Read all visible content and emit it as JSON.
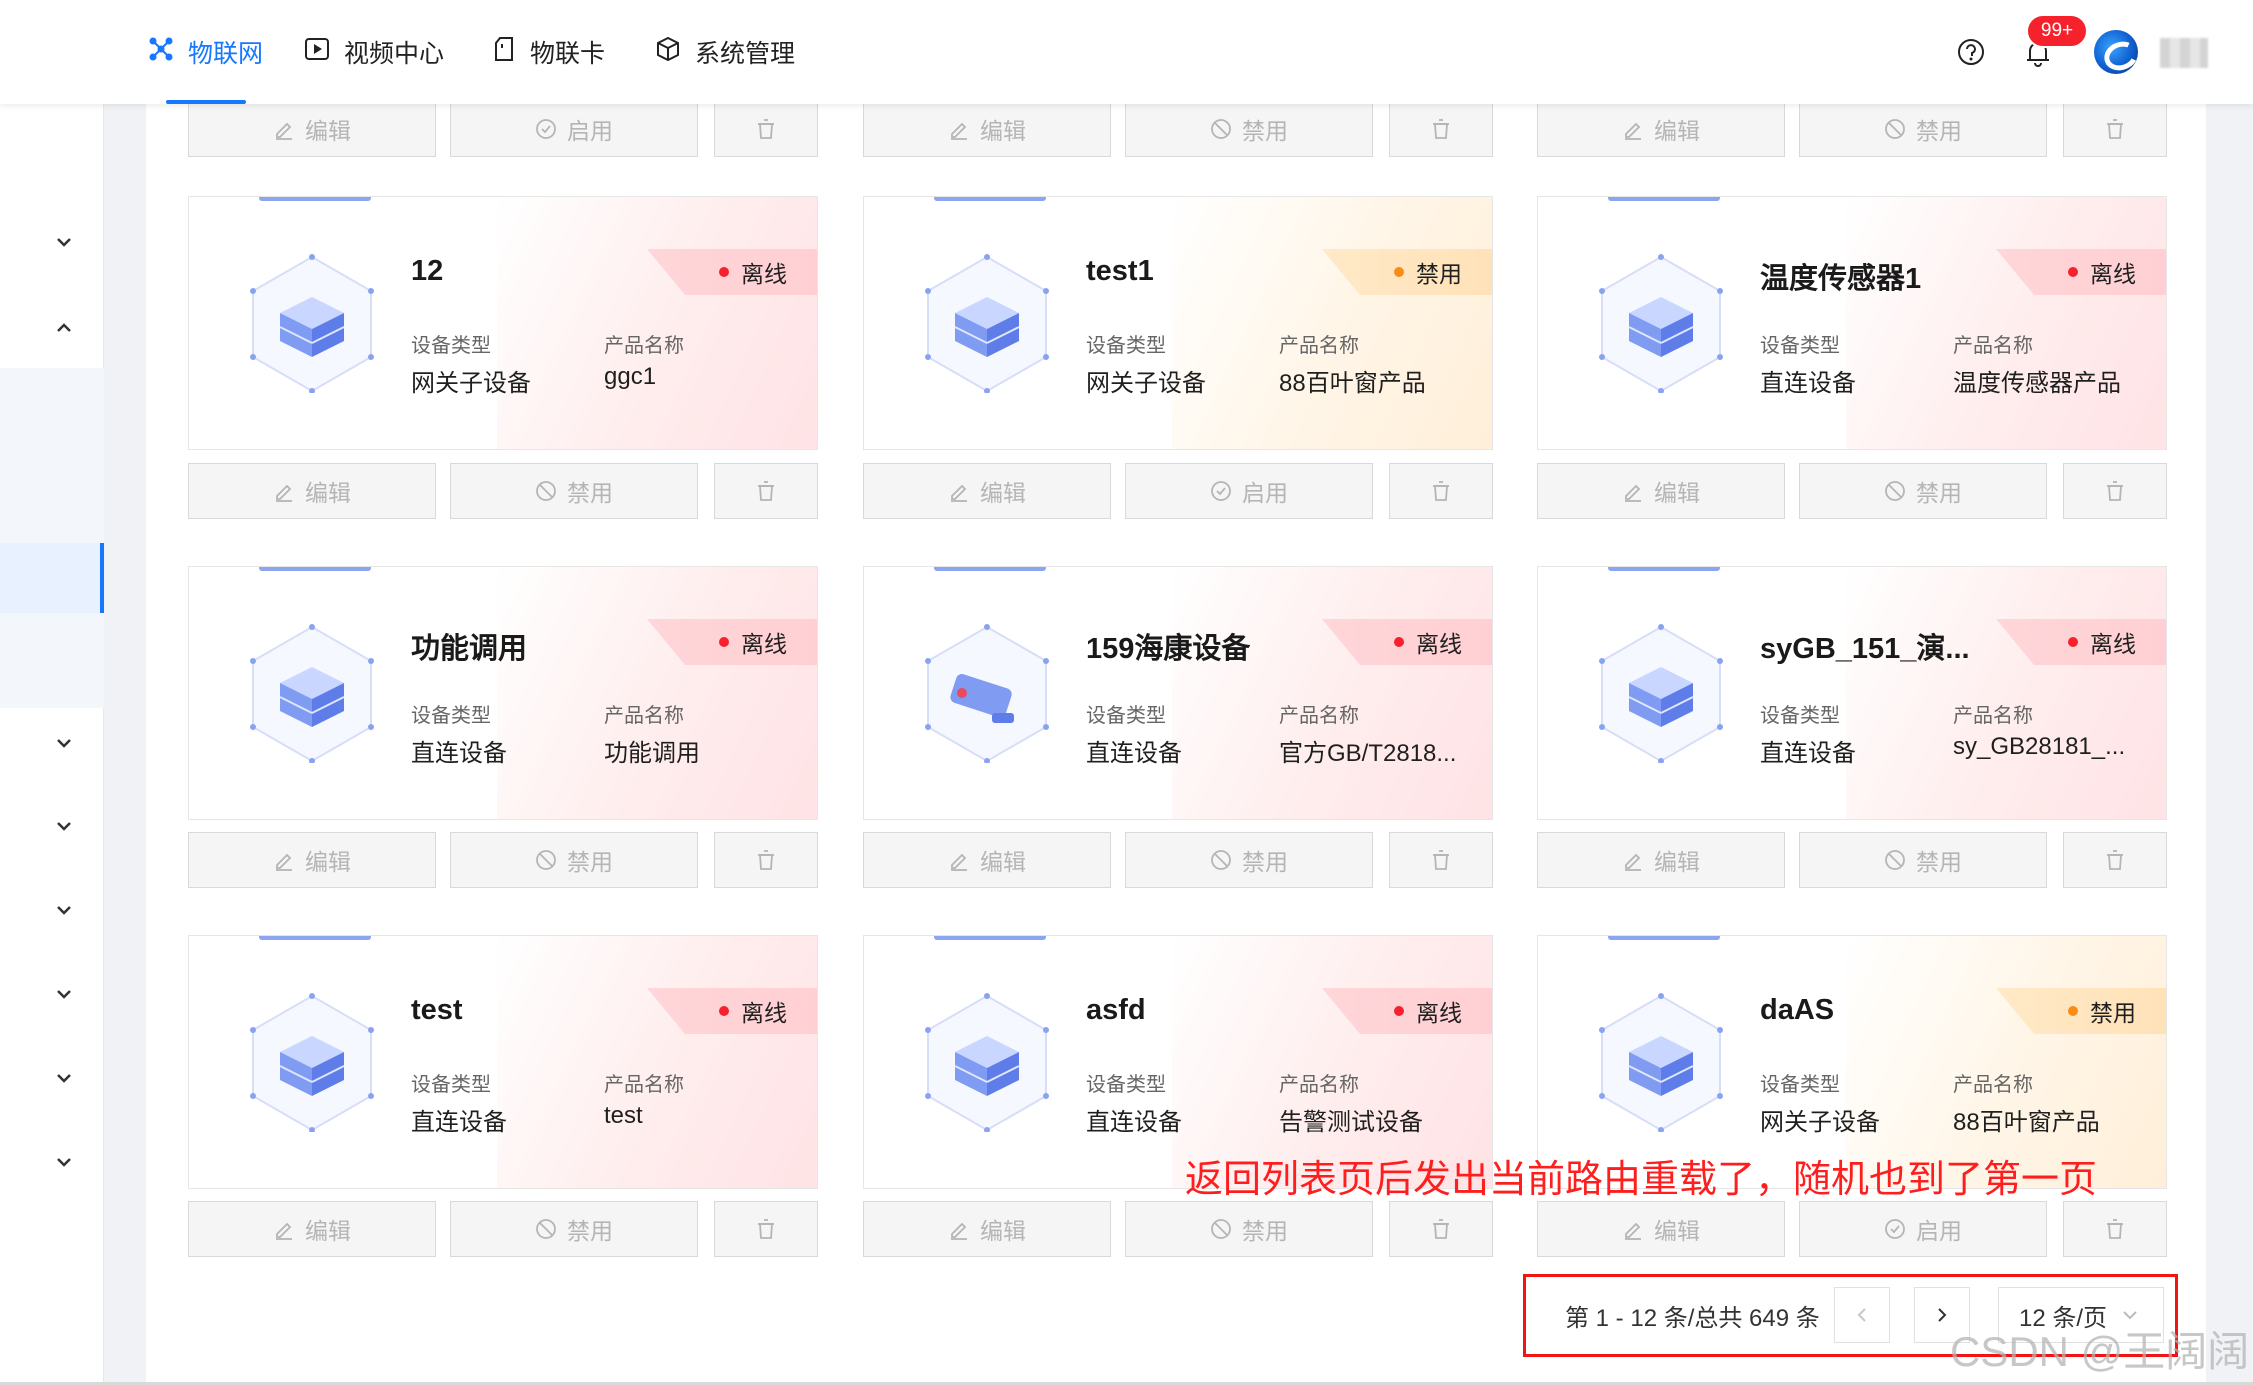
{
  "nav": {
    "items": [
      {
        "label": "物联网",
        "icon": "iot-icon",
        "active": true
      },
      {
        "label": "视频中心",
        "icon": "play-icon",
        "active": false
      },
      {
        "label": "物联卡",
        "icon": "sim-card-icon",
        "active": false
      },
      {
        "label": "系统管理",
        "icon": "cube-icon",
        "active": false
      }
    ],
    "notification_badge": "99+",
    "accent": "#1677ff"
  },
  "top_buttons": [
    [
      "编辑",
      "启用"
    ],
    [
      "编辑",
      "禁用"
    ],
    [
      "编辑",
      "禁用"
    ]
  ],
  "field_labels": {
    "type": "设备类型",
    "product": "产品名称"
  },
  "cards": [
    {
      "name": "12",
      "status": "离线",
      "type": "网关子设备",
      "product": "ggc1",
      "action": "禁用",
      "icon": "server-icon"
    },
    {
      "name": "test1",
      "status": "禁用",
      "type": "网关子设备",
      "product": "88百叶窗产品",
      "action": "启用",
      "icon": "server-icon"
    },
    {
      "name": "温度传感器1",
      "status": "离线",
      "type": "直连设备",
      "product": "温度传感器产品",
      "action": "禁用",
      "icon": "server-icon"
    },
    {
      "name": "功能调用",
      "status": "离线",
      "type": "直连设备",
      "product": "功能调用",
      "action": "禁用",
      "icon": "server-icon"
    },
    {
      "name": "159海康设备",
      "status": "离线",
      "type": "直连设备",
      "product": "官方GB/T2818...",
      "action": "禁用",
      "icon": "camera-icon"
    },
    {
      "name": "syGB_151_演...",
      "status": "离线",
      "type": "直连设备",
      "product": "sy_GB28181_...",
      "action": "禁用",
      "icon": "server-icon"
    },
    {
      "name": "test",
      "status": "离线",
      "type": "直连设备",
      "product": "test",
      "action": "禁用",
      "icon": "server-icon"
    },
    {
      "name": "asfd",
      "status": "离线",
      "type": "直连设备",
      "product": "告警测试设备",
      "action": "禁用",
      "icon": "server-icon"
    },
    {
      "name": "daAS",
      "status": "禁用",
      "type": "网关子设备",
      "product": "88百叶窗产品",
      "action": "启用",
      "icon": "server-icon"
    }
  ],
  "edit_label": "编辑",
  "annotation": "返回列表页后发出当前路由重载了，随机也到了第一页",
  "pagination": {
    "summary": "第 1 - 12 条/总共 649 条",
    "page_size": "12 条/页"
  },
  "watermark": "CSDN @王阔阔",
  "colors": {
    "offline": "#f5222d",
    "disabled": "#fa8c16",
    "annotation": "#ff1e1e"
  }
}
